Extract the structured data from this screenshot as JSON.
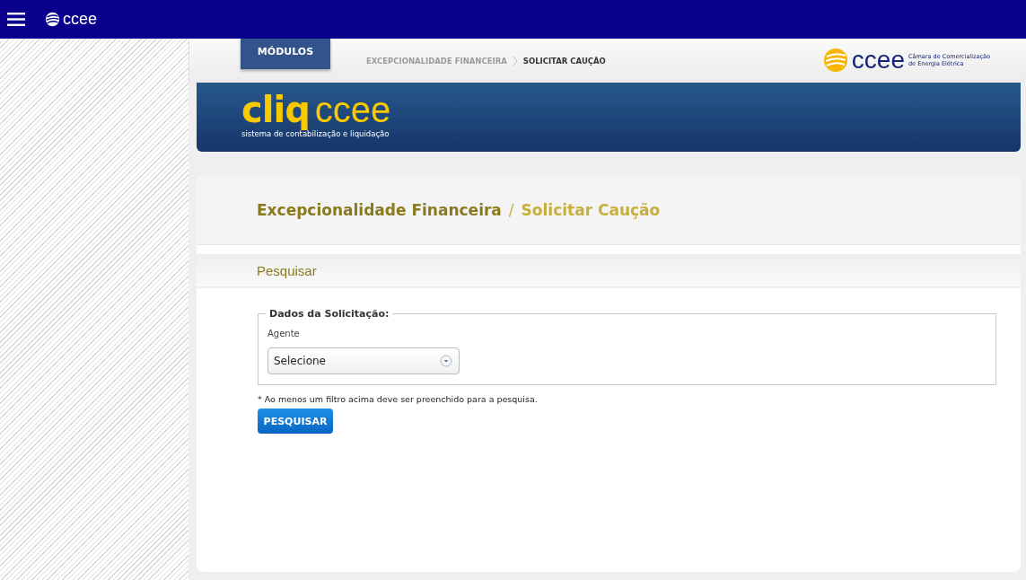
{
  "top_bar": {
    "logo_text": "ccee"
  },
  "header": {
    "modules_button": "MÓDULOS",
    "breadcrumb": [
      {
        "label": "EXCEPCIONALIDADE FINANCEIRA",
        "current": false
      },
      {
        "label": "SOLICITAR CAUÇÃO",
        "current": true
      }
    ],
    "brand": {
      "name": "ccee",
      "tagline": [
        "Câmara de Comercialização",
        "de Energia Elétrica"
      ]
    }
  },
  "banner": {
    "logo_bold": "cliq",
    "logo_light": "ccee",
    "subtitle": "sistema de contabilização e liquidação"
  },
  "page_title": {
    "section": "Excepcionalidade Financeira",
    "separator": "/",
    "page": "Solicitar Caução"
  },
  "search": {
    "title": "Pesquisar",
    "legend": "Dados da Solicitação:",
    "field_label": "Agente",
    "select_value": "Selecione",
    "note": "* Ao menos um filtro acima deve ser preenchido para a pesquisa.",
    "button": "PESQUISAR"
  }
}
